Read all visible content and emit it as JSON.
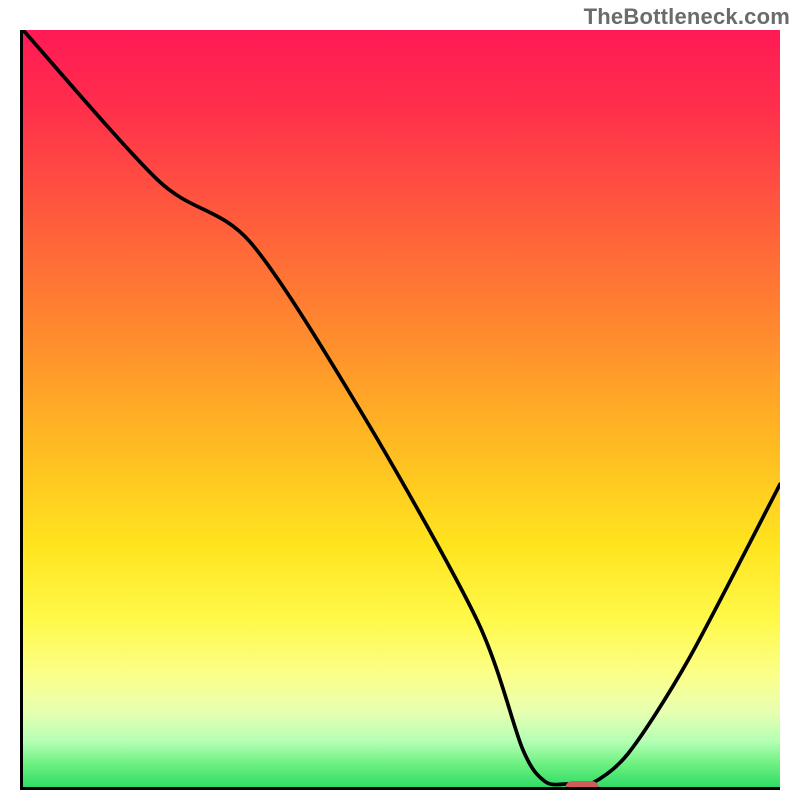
{
  "watermark": "TheBottleneck.com",
  "chart_data": {
    "type": "line",
    "title": "",
    "xlabel": "",
    "ylabel": "",
    "xlim": [
      0,
      100
    ],
    "ylim": [
      0,
      100
    ],
    "grid": false,
    "legend": false,
    "series": [
      {
        "name": "curve",
        "color": "#000000",
        "x": [
          0,
          18,
          30,
          45,
          60,
          66,
          69,
          72,
          75,
          80,
          88,
          100
        ],
        "values": [
          100,
          80,
          72,
          49,
          22,
          5,
          0.7,
          0.4,
          0.4,
          4.5,
          17,
          40
        ]
      }
    ],
    "background_gradient": {
      "direction": "top-to-bottom",
      "stops": [
        {
          "pos": 0.0,
          "color": "#ff1a55"
        },
        {
          "pos": 0.25,
          "color": "#ff5c3c"
        },
        {
          "pos": 0.55,
          "color": "#ffbb22"
        },
        {
          "pos": 0.78,
          "color": "#fff94a"
        },
        {
          "pos": 0.94,
          "color": "#b4ffb4"
        },
        {
          "pos": 1.0,
          "color": "#2fdc66"
        }
      ]
    },
    "marker": {
      "x": 73.5,
      "y": 0.15,
      "color": "#d25a5a",
      "shape": "pill"
    }
  }
}
